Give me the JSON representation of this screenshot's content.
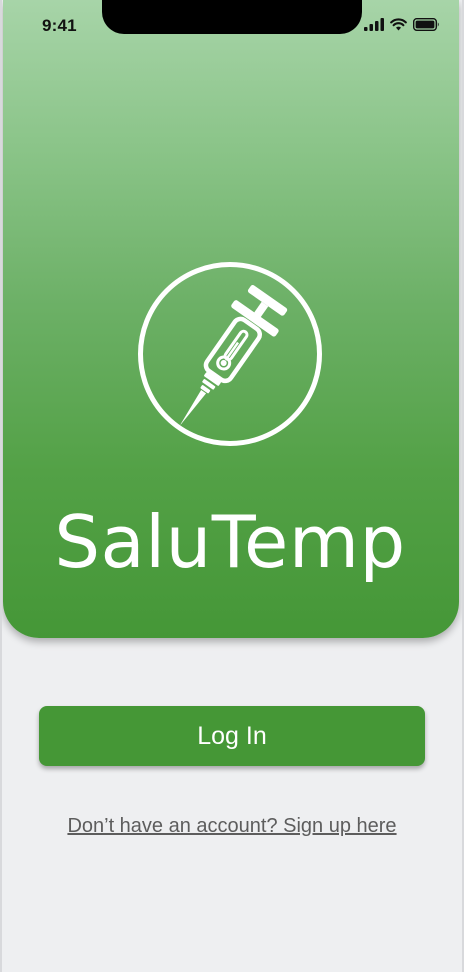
{
  "status_bar": {
    "time": "9:41",
    "icons": [
      "signal-icon",
      "wifi-icon",
      "battery-icon"
    ]
  },
  "branding": {
    "app_name": "SaluTemp",
    "logo_icon": "syringe-thermometer-icon"
  },
  "actions": {
    "login_label": "Log In",
    "signup_text": "Don’t have an account? Sign up here"
  },
  "colors": {
    "primary_green": "#459736",
    "gradient_top": "#a7d4a8",
    "background": "#eeeff1",
    "link_text": "#5d5d5d"
  }
}
